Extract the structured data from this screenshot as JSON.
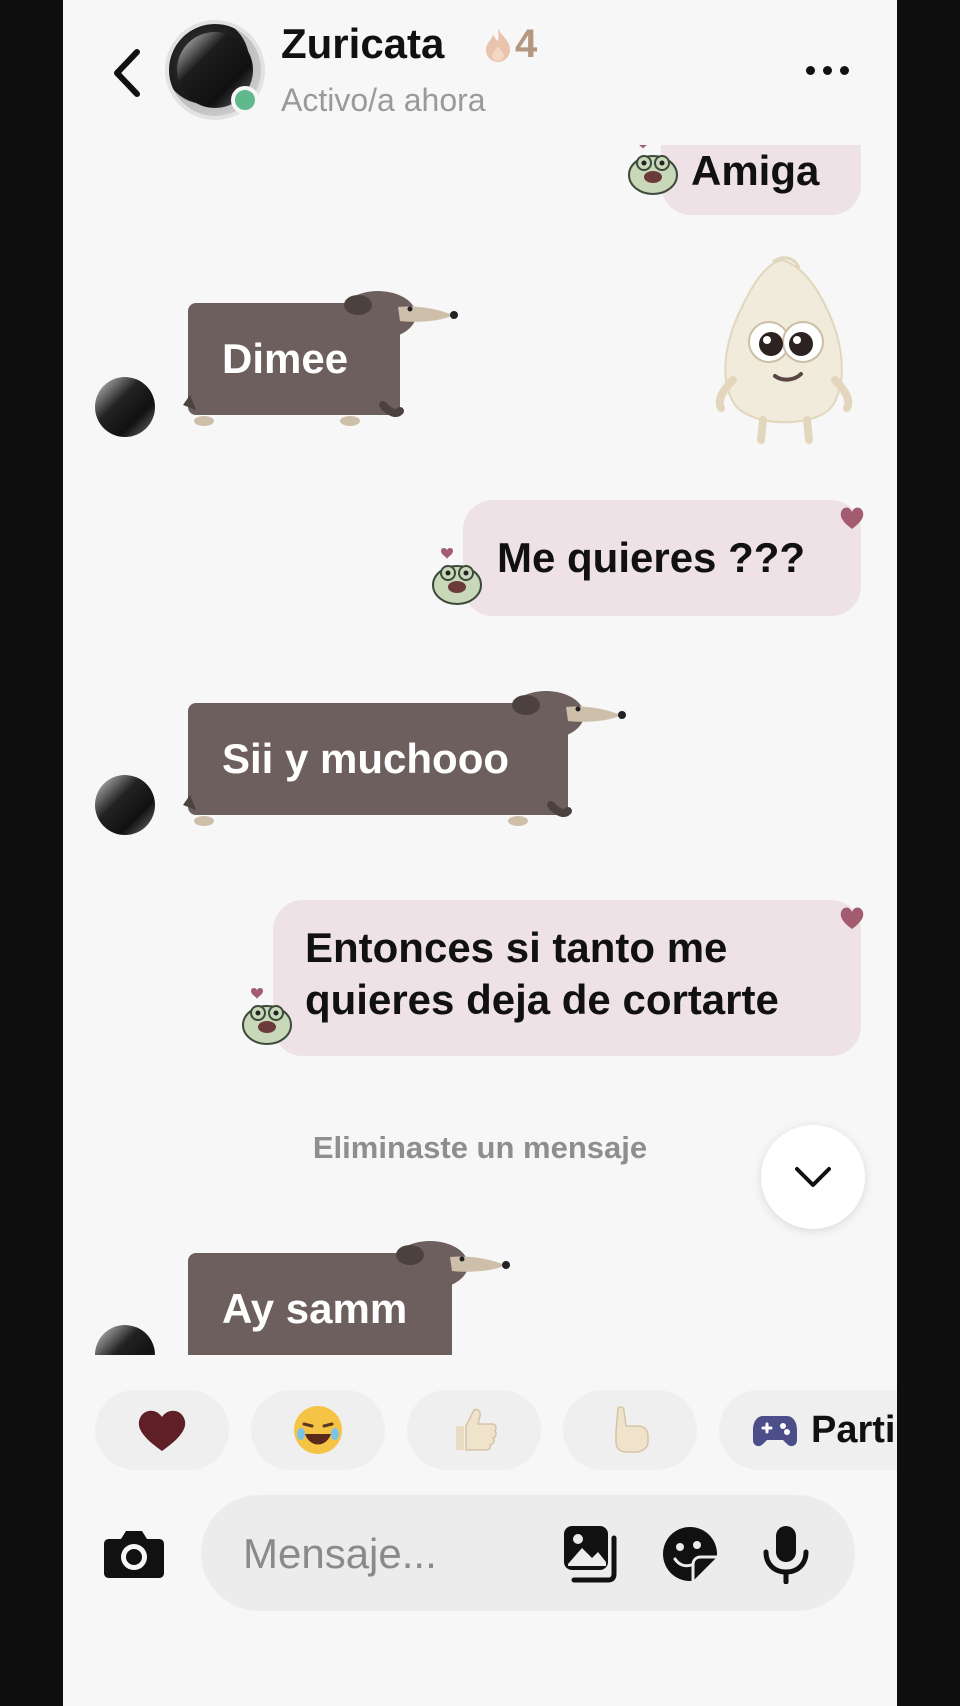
{
  "header": {
    "contact_name": "Zuricata",
    "streak_count": "4",
    "status": "Activo/a ahora"
  },
  "messages": {
    "amiga": "Amiga",
    "dimee": "Dimee",
    "me_quieres": "Me quieres ???",
    "sii": "Sii y muchooo",
    "entonces_line1": "Entonces si tanto me",
    "entonces_line2": "quieres deja de cortarte",
    "ay_samm": "Ay samm"
  },
  "deleted_note": "Eliminaste un mensaje",
  "quick_replies": {
    "game_label": "Parti"
  },
  "input": {
    "placeholder": "Mensaje..."
  },
  "colors": {
    "outgoing_bubble": "#efe2e6",
    "incoming_bubble": "#6d5f5d",
    "online": "#5fb98a",
    "streak": "#b5967f"
  }
}
